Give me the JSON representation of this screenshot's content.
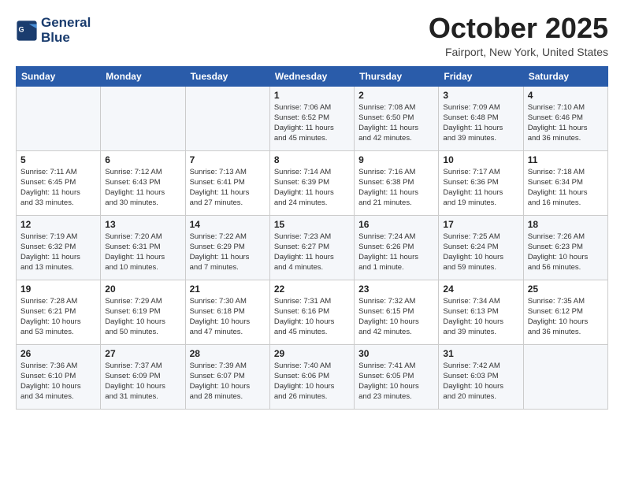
{
  "header": {
    "logo_line1": "General",
    "logo_line2": "Blue",
    "month_title": "October 2025",
    "location": "Fairport, New York, United States"
  },
  "days_of_week": [
    "Sunday",
    "Monday",
    "Tuesday",
    "Wednesday",
    "Thursday",
    "Friday",
    "Saturday"
  ],
  "weeks": [
    [
      {
        "day": "",
        "info": ""
      },
      {
        "day": "",
        "info": ""
      },
      {
        "day": "",
        "info": ""
      },
      {
        "day": "1",
        "info": "Sunrise: 7:06 AM\nSunset: 6:52 PM\nDaylight: 11 hours\nand 45 minutes."
      },
      {
        "day": "2",
        "info": "Sunrise: 7:08 AM\nSunset: 6:50 PM\nDaylight: 11 hours\nand 42 minutes."
      },
      {
        "day": "3",
        "info": "Sunrise: 7:09 AM\nSunset: 6:48 PM\nDaylight: 11 hours\nand 39 minutes."
      },
      {
        "day": "4",
        "info": "Sunrise: 7:10 AM\nSunset: 6:46 PM\nDaylight: 11 hours\nand 36 minutes."
      }
    ],
    [
      {
        "day": "5",
        "info": "Sunrise: 7:11 AM\nSunset: 6:45 PM\nDaylight: 11 hours\nand 33 minutes."
      },
      {
        "day": "6",
        "info": "Sunrise: 7:12 AM\nSunset: 6:43 PM\nDaylight: 11 hours\nand 30 minutes."
      },
      {
        "day": "7",
        "info": "Sunrise: 7:13 AM\nSunset: 6:41 PM\nDaylight: 11 hours\nand 27 minutes."
      },
      {
        "day": "8",
        "info": "Sunrise: 7:14 AM\nSunset: 6:39 PM\nDaylight: 11 hours\nand 24 minutes."
      },
      {
        "day": "9",
        "info": "Sunrise: 7:16 AM\nSunset: 6:38 PM\nDaylight: 11 hours\nand 21 minutes."
      },
      {
        "day": "10",
        "info": "Sunrise: 7:17 AM\nSunset: 6:36 PM\nDaylight: 11 hours\nand 19 minutes."
      },
      {
        "day": "11",
        "info": "Sunrise: 7:18 AM\nSunset: 6:34 PM\nDaylight: 11 hours\nand 16 minutes."
      }
    ],
    [
      {
        "day": "12",
        "info": "Sunrise: 7:19 AM\nSunset: 6:32 PM\nDaylight: 11 hours\nand 13 minutes."
      },
      {
        "day": "13",
        "info": "Sunrise: 7:20 AM\nSunset: 6:31 PM\nDaylight: 11 hours\nand 10 minutes."
      },
      {
        "day": "14",
        "info": "Sunrise: 7:22 AM\nSunset: 6:29 PM\nDaylight: 11 hours\nand 7 minutes."
      },
      {
        "day": "15",
        "info": "Sunrise: 7:23 AM\nSunset: 6:27 PM\nDaylight: 11 hours\nand 4 minutes."
      },
      {
        "day": "16",
        "info": "Sunrise: 7:24 AM\nSunset: 6:26 PM\nDaylight: 11 hours\nand 1 minute."
      },
      {
        "day": "17",
        "info": "Sunrise: 7:25 AM\nSunset: 6:24 PM\nDaylight: 10 hours\nand 59 minutes."
      },
      {
        "day": "18",
        "info": "Sunrise: 7:26 AM\nSunset: 6:23 PM\nDaylight: 10 hours\nand 56 minutes."
      }
    ],
    [
      {
        "day": "19",
        "info": "Sunrise: 7:28 AM\nSunset: 6:21 PM\nDaylight: 10 hours\nand 53 minutes."
      },
      {
        "day": "20",
        "info": "Sunrise: 7:29 AM\nSunset: 6:19 PM\nDaylight: 10 hours\nand 50 minutes."
      },
      {
        "day": "21",
        "info": "Sunrise: 7:30 AM\nSunset: 6:18 PM\nDaylight: 10 hours\nand 47 minutes."
      },
      {
        "day": "22",
        "info": "Sunrise: 7:31 AM\nSunset: 6:16 PM\nDaylight: 10 hours\nand 45 minutes."
      },
      {
        "day": "23",
        "info": "Sunrise: 7:32 AM\nSunset: 6:15 PM\nDaylight: 10 hours\nand 42 minutes."
      },
      {
        "day": "24",
        "info": "Sunrise: 7:34 AM\nSunset: 6:13 PM\nDaylight: 10 hours\nand 39 minutes."
      },
      {
        "day": "25",
        "info": "Sunrise: 7:35 AM\nSunset: 6:12 PM\nDaylight: 10 hours\nand 36 minutes."
      }
    ],
    [
      {
        "day": "26",
        "info": "Sunrise: 7:36 AM\nSunset: 6:10 PM\nDaylight: 10 hours\nand 34 minutes."
      },
      {
        "day": "27",
        "info": "Sunrise: 7:37 AM\nSunset: 6:09 PM\nDaylight: 10 hours\nand 31 minutes."
      },
      {
        "day": "28",
        "info": "Sunrise: 7:39 AM\nSunset: 6:07 PM\nDaylight: 10 hours\nand 28 minutes."
      },
      {
        "day": "29",
        "info": "Sunrise: 7:40 AM\nSunset: 6:06 PM\nDaylight: 10 hours\nand 26 minutes."
      },
      {
        "day": "30",
        "info": "Sunrise: 7:41 AM\nSunset: 6:05 PM\nDaylight: 10 hours\nand 23 minutes."
      },
      {
        "day": "31",
        "info": "Sunrise: 7:42 AM\nSunset: 6:03 PM\nDaylight: 10 hours\nand 20 minutes."
      },
      {
        "day": "",
        "info": ""
      }
    ]
  ]
}
